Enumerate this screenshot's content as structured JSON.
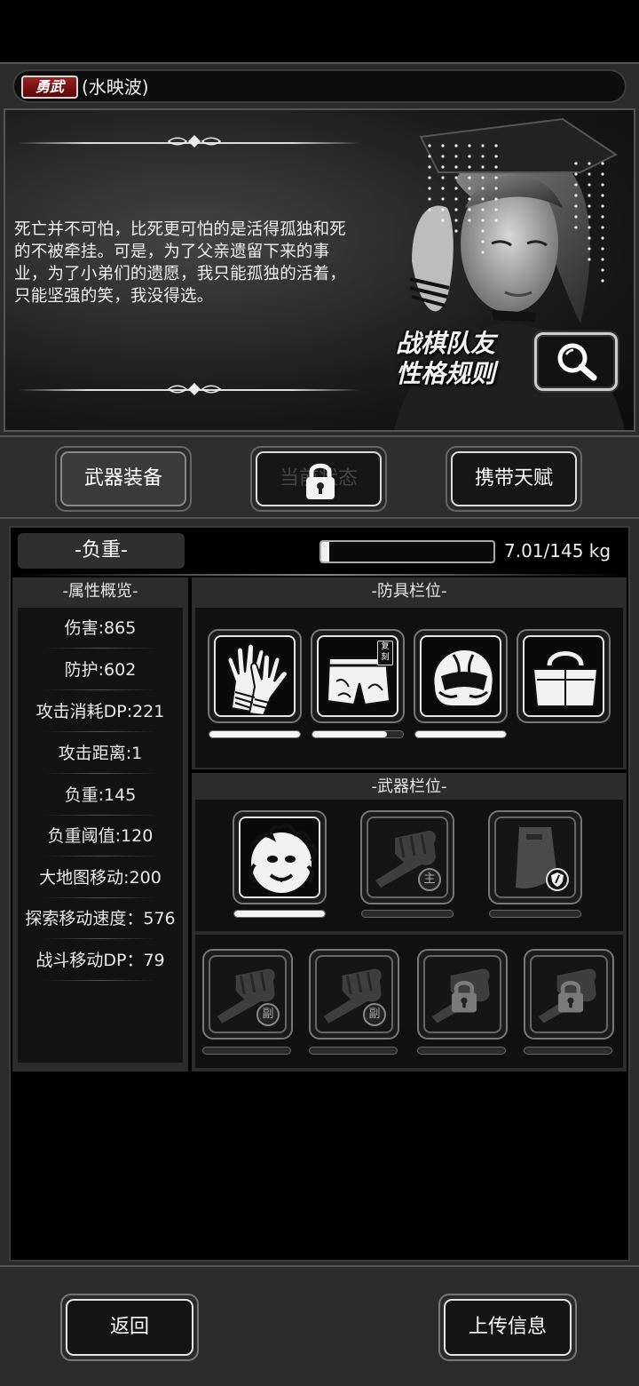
{
  "character": {
    "rank_badge": "勇武",
    "name": "(水映波)"
  },
  "banner": {
    "quote": "死亡并不可怕，比死更可怕的是活得孤独和死的不被牵挂。可是，为了父亲遗留下来的事业，为了小弟们的遗愿，我只能孤独的活着，只能坚强的笑，我没得选。",
    "rules_label_line1": "战棋队友",
    "rules_label_line2": "性格规则",
    "magnify_icon": "magnify-icon"
  },
  "tabs": {
    "weapon_equipment": "武器装备",
    "locked_tab": "当前状态",
    "carried_talents": "携带天赋"
  },
  "weight": {
    "label": "-负重-",
    "current": 7.01,
    "max": 145,
    "display": "7.01/145 kg"
  },
  "attributes": {
    "title": "-属性概览-",
    "items": [
      "伤害:865",
      "防护:602",
      "攻击消耗DP:221",
      "攻击距离:1",
      "负重:145",
      "负重阈值:120",
      "大地图移动:200",
      "探索移动速度：576",
      "战斗移动DP：79"
    ]
  },
  "armor": {
    "title": "-防具栏位-",
    "slots": [
      {
        "icon": "gloves-icon",
        "durability": 1.0
      },
      {
        "icon": "shorts-icon",
        "badge": "复刻",
        "durability": 0.82
      },
      {
        "icon": "helmet-icon",
        "durability": 1.0
      },
      {
        "icon": "bag-icon"
      }
    ]
  },
  "weapons": {
    "title": "-武器栏位-",
    "main_slots": [
      {
        "icon": "medusa-weapon-icon",
        "durability": 1.0
      },
      {
        "icon": "fist-icon",
        "tag": "主"
      },
      {
        "icon": "riot-shield-icon",
        "tag_icon": "shield-badge-icon"
      }
    ],
    "sub_slots": [
      {
        "icon": "fist-icon",
        "tag": "副"
      },
      {
        "icon": "fist-icon",
        "tag": "副"
      },
      {
        "icon": "fist-icon",
        "locked": true
      },
      {
        "icon": "fist-icon",
        "locked": true
      }
    ]
  },
  "bottom": {
    "back": "返回",
    "upload": "上传信息"
  }
}
